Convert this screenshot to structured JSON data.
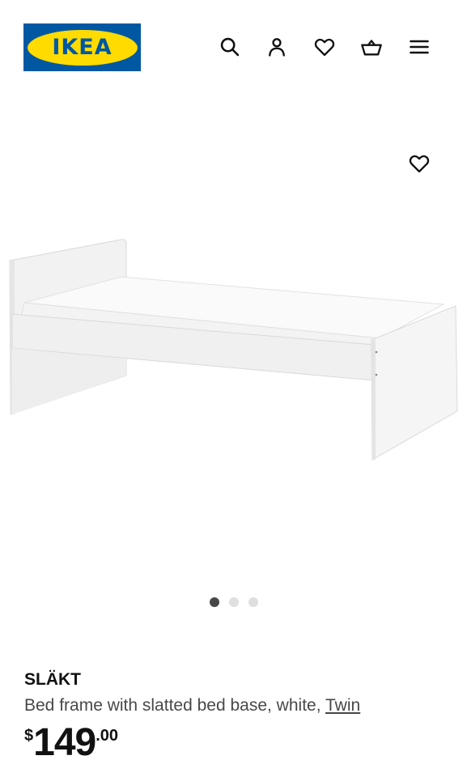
{
  "header": {
    "logo_text": "IKEA",
    "icons": [
      "search-icon",
      "account-icon",
      "heart-icon",
      "basket-icon",
      "menu-icon"
    ]
  },
  "gallery": {
    "image": "white single bed frame",
    "favorite_icon": "heart-icon",
    "dots_count": 3,
    "active_dot": 1
  },
  "product": {
    "name": "SLÄKT",
    "description": "Bed frame with slatted bed base, white, ",
    "size_link": "Twin",
    "price_currency": "$",
    "price_integer": "149",
    "price_decimal": ".00"
  },
  "colors": {
    "ikea_blue": "#0058a3",
    "ikea_yellow": "#ffdb00",
    "text": "#111111",
    "muted_text": "#484848"
  }
}
